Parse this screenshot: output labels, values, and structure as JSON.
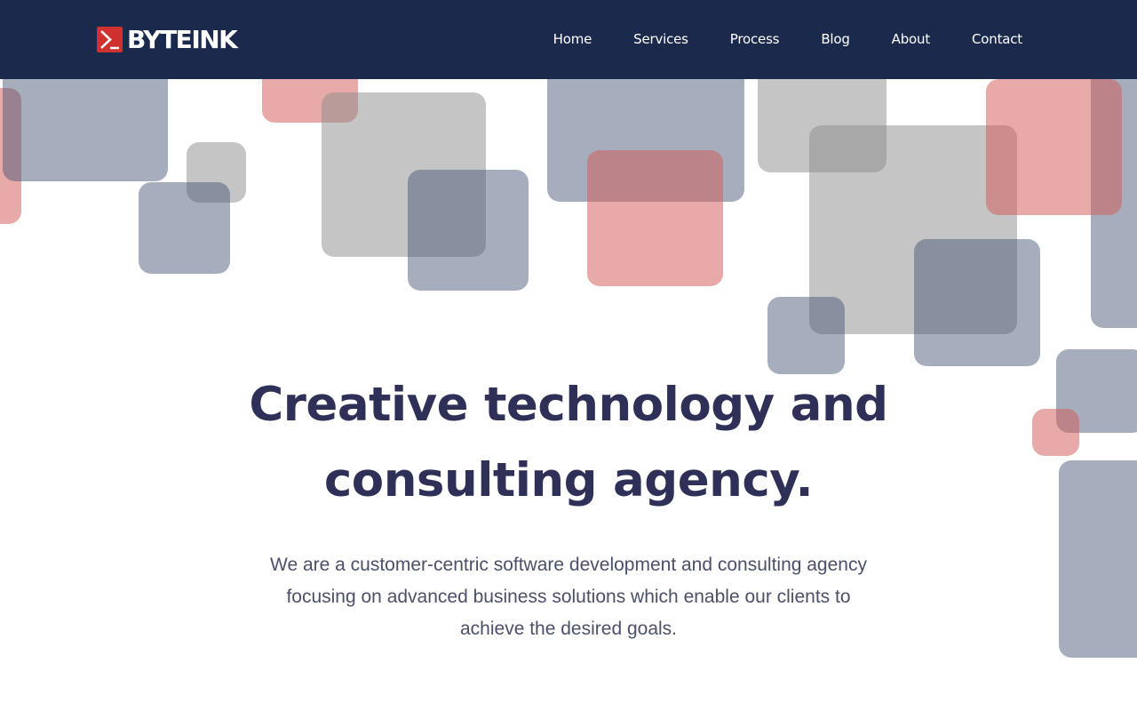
{
  "brand": {
    "name": "BYTEINK",
    "logo_icon": "terminal-prompt-icon",
    "logo_color": "#d0302e"
  },
  "nav": {
    "items": [
      {
        "label": "Home"
      },
      {
        "label": "Services"
      },
      {
        "label": "Process"
      },
      {
        "label": "Blog"
      },
      {
        "label": "About"
      },
      {
        "label": "Contact"
      }
    ]
  },
  "hero": {
    "title": "Creative technology and consulting agency.",
    "description": "We are a customer-centric software development and consulting agency focusing on advanced business solutions which enable our clients to achieve the desired goals."
  },
  "colors": {
    "header_bg": "#1b2a4c",
    "title": "#2f3058",
    "body_text": "#4a5068",
    "shape_slate": "#465678",
    "shape_grey": "#8c8c8c",
    "shape_coral": "#d15c58"
  }
}
